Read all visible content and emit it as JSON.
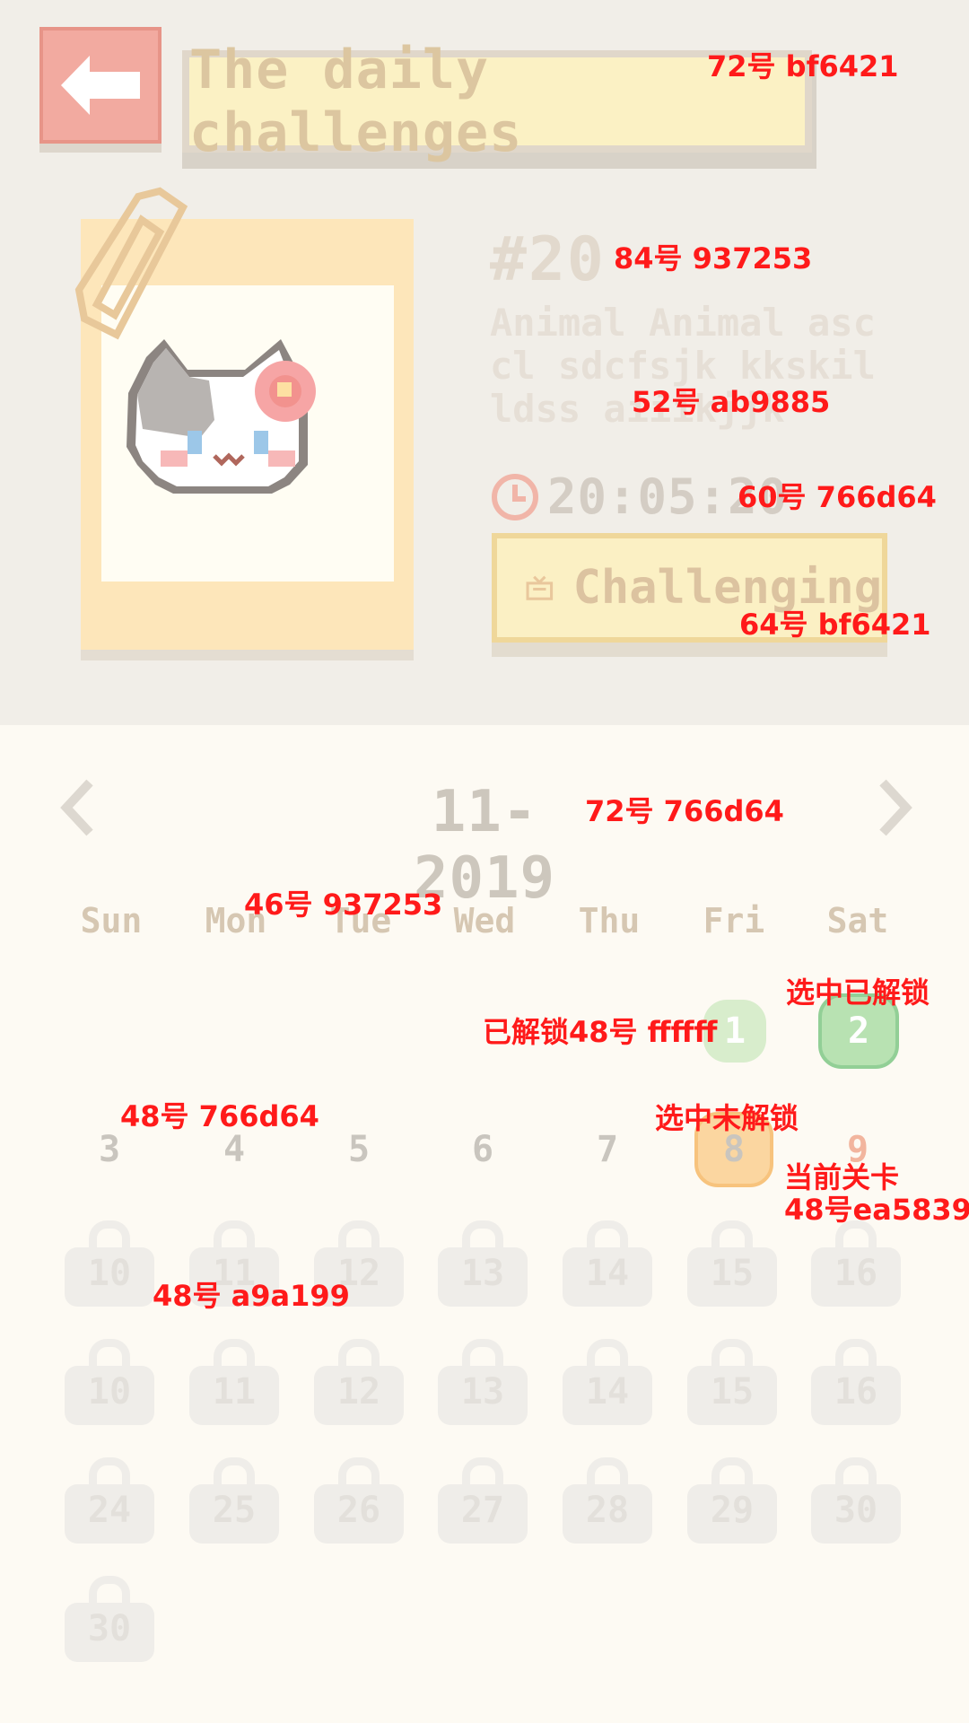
{
  "header": {
    "back_label": "back",
    "title": "The daily challenges",
    "title_note": "72号 bf6421"
  },
  "level": {
    "number": "#20",
    "number_note": "84号 937253",
    "description": "Animal Animal asccl sdcfsjk kkskil ldss aiiikjjk",
    "description_note": "52号 ab9885",
    "timer": "20:05:20",
    "timer_note": "60号 766d64",
    "challenge_label": "Challenging",
    "challenge_note": "64号 bf6421",
    "icons": {
      "clock": "clock-icon",
      "tv": "tv-icon",
      "cat": "cat-picture"
    }
  },
  "calendar": {
    "month": "11-2019",
    "month_note": "72号 766d64",
    "weekday_note": "46号 937253",
    "weekdays": [
      "Sun",
      "Mon",
      "Tue",
      "Wed",
      "Thu",
      "Fri",
      "Sat"
    ],
    "unlocked_note": "已解锁48号 ffffff",
    "selected_unlocked_note": "选中已解锁",
    "normal_note": "48号 766d64",
    "selected_locked_note": "选中未解锁",
    "current_note_1": "当前关卡",
    "current_note_2": "48号ea5839",
    "locked_note": "48号 a9a199",
    "days_row1": [
      "1",
      "2"
    ],
    "days_row2": [
      "3",
      "4",
      "5",
      "6",
      "7",
      "8",
      "9"
    ],
    "locked_rows": [
      [
        "10",
        "11",
        "12",
        "13",
        "14",
        "15",
        "16"
      ],
      [
        "10",
        "11",
        "12",
        "13",
        "14",
        "15",
        "16"
      ],
      [
        "24",
        "25",
        "26",
        "27",
        "28",
        "29",
        "30"
      ],
      [
        "30"
      ]
    ]
  },
  "colors": {
    "bg_top": "#f1eee8",
    "bg_bottom": "#fdfaf3",
    "accent_title": "#bf6421",
    "number": "#937253",
    "desc": "#ab9885",
    "normal_text": "#766d64",
    "current": "#ea5839",
    "locked": "#a9a199",
    "unlocked_green": "#d6eccb",
    "selected_green": "#b9e2b4",
    "selected_orange": "#fcd6a0"
  }
}
